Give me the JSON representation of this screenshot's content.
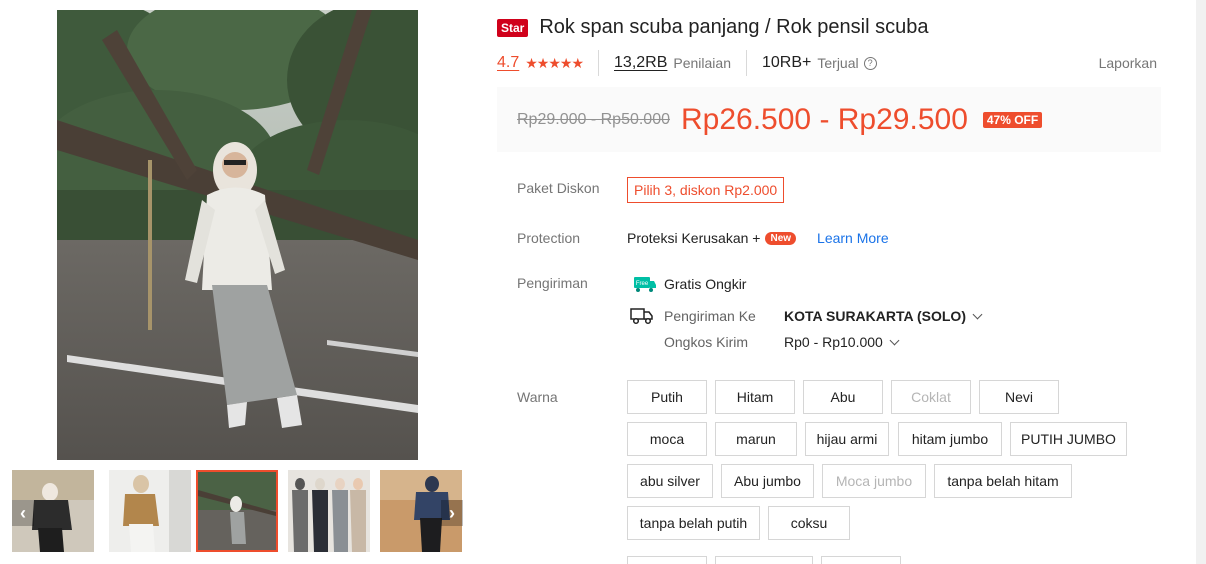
{
  "gallery": {
    "thumbnails": [
      "thumbnail-1",
      "thumbnail-2",
      "thumbnail-3",
      "thumbnail-4",
      "thumbnail-5"
    ],
    "active_index": 2,
    "prev_icon": "chevron-left-icon",
    "next_icon": "chevron-right-icon"
  },
  "product": {
    "badge": "Star",
    "title": "Rok span scuba panjang / Rok pensil scuba",
    "rating": "4.7",
    "rating_value": 4.7,
    "stars_glyph": "★★★★★",
    "review_count": "13,2RB",
    "review_label": "Penilaian",
    "sold_count": "10RB+",
    "sold_label": "Terjual",
    "help_glyph": "?",
    "report": "Laporkan"
  },
  "price": {
    "original": "Rp29.000 - Rp50.000",
    "current": "Rp26.500 - Rp29.500",
    "discount": "47% OFF"
  },
  "paket": {
    "label": "Paket Diskon",
    "value": "Pilih 3, diskon Rp2.000"
  },
  "protection": {
    "label": "Protection",
    "name": "Proteksi Kerusakan +",
    "badge": "New",
    "link": "Learn More"
  },
  "shipping": {
    "label": "Pengiriman",
    "free_icon_text": "Free",
    "free_label": "Gratis Ongkir",
    "to_label": "Pengiriman Ke",
    "to_value": "KOTA SURAKARTA (SOLO)",
    "cost_label": "Ongkos Kirim",
    "cost_value": "Rp0 - Rp10.000"
  },
  "variation": {
    "label": "Warna",
    "options": [
      {
        "text": "Putih",
        "disabled": false
      },
      {
        "text": "Hitam",
        "disabled": false
      },
      {
        "text": "Abu",
        "disabled": false
      },
      {
        "text": "Coklat",
        "disabled": true
      },
      {
        "text": "Nevi",
        "disabled": false
      },
      {
        "text": "moca",
        "disabled": false
      },
      {
        "text": "marun",
        "disabled": false
      },
      {
        "text": "hijau armi",
        "disabled": false
      },
      {
        "text": "hitam jumbo",
        "disabled": false
      },
      {
        "text": "PUTIH JUMBO",
        "disabled": false
      },
      {
        "text": "abu silver",
        "disabled": false
      },
      {
        "text": "Abu jumbo",
        "disabled": false
      },
      {
        "text": "Moca jumbo",
        "disabled": true
      },
      {
        "text": "tanpa belah hitam",
        "disabled": false
      },
      {
        "text": "tanpa belah putih",
        "disabled": false
      },
      {
        "text": "coksu",
        "disabled": false
      }
    ]
  },
  "colors": {
    "accent": "#ee4d2d",
    "star_badge": "#d0011b",
    "link": "#1a73e8",
    "free_shipping": "#00bfa5"
  }
}
